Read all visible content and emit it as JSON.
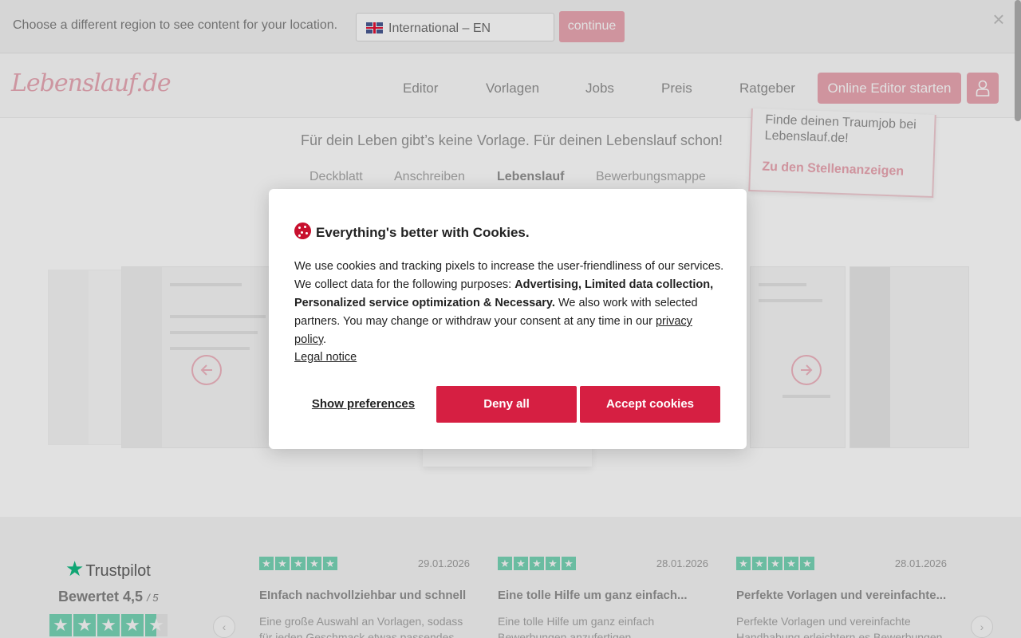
{
  "region_bar": {
    "prompt": "Choose a different region to see content for your location.",
    "selected_region": "International – EN",
    "flag_icon": "uk-flag-icon",
    "continue_label": "continue",
    "close_icon": "close-icon"
  },
  "header": {
    "logo_text": "Lebenslauf.de",
    "nav": [
      "Editor",
      "Vorlagen",
      "Jobs",
      "Preis",
      "Ratgeber"
    ],
    "start_editor_label": "Online Editor starten",
    "account_icon": "user-icon"
  },
  "hero": {
    "tagline": "Für dein Leben gibt’s keine Vorlage. Für deinen Lebenslauf schon!",
    "tabs": [
      "Deckblatt",
      "Anschreiben",
      "Lebenslauf",
      "Bewerbungsmappe"
    ],
    "active_tab": "Lebenslauf"
  },
  "job_card": {
    "text": "Finde deinen Traumjob bei Lebenslauf.de!",
    "link": "Zu den Stellenanzeigen"
  },
  "trustpilot": {
    "brand": "Trustpilot",
    "rating_label": "Bewertet 4,5",
    "rating_scale": "/ 5",
    "rating_value": 4.5,
    "reviews": [
      {
        "date": "29.01.2026",
        "stars": 5,
        "title": "EInfach nachvollziehbar und schnell",
        "body": "Eine große Auswahl an Vorlagen, sodass für jeden Geschmack etwas passendes"
      },
      {
        "date": "28.01.2026",
        "stars": 5,
        "title": "Eine tolle Hilfe um ganz einfach...",
        "body": "Eine tolle Hilfe um ganz einfach Bewerbungen anzufertigen"
      },
      {
        "date": "28.01.2026",
        "stars": 5,
        "title": "Perfekte Vorlagen und vereinfachte...",
        "body": "Perfekte Vorlagen und vereinfachte Handhabung erleichtern es Bewerbungen"
      }
    ]
  },
  "cookie_modal": {
    "title": "Everything's better with Cookies.",
    "text_intro": "We use cookies and tracking pixels to increase the user-friendliness of our services. We collect data for the following purposes: ",
    "text_purposes": "Advertising, Limited data collection, Personalized service optimization & Necessary.",
    "text_outro": " We also work with selected partners. You may change or withdraw your consent at any time in our ",
    "privacy_link": "privacy policy",
    "period": ".",
    "legal_link": "Legal notice",
    "show_preferences_label": "Show preferences",
    "deny_label": "Deny all",
    "accept_label": "Accept cookies"
  },
  "colors": {
    "brand": "#d61f42",
    "brand_faded": "#e9a1ae",
    "trustpilot_green": "#00b67a"
  }
}
